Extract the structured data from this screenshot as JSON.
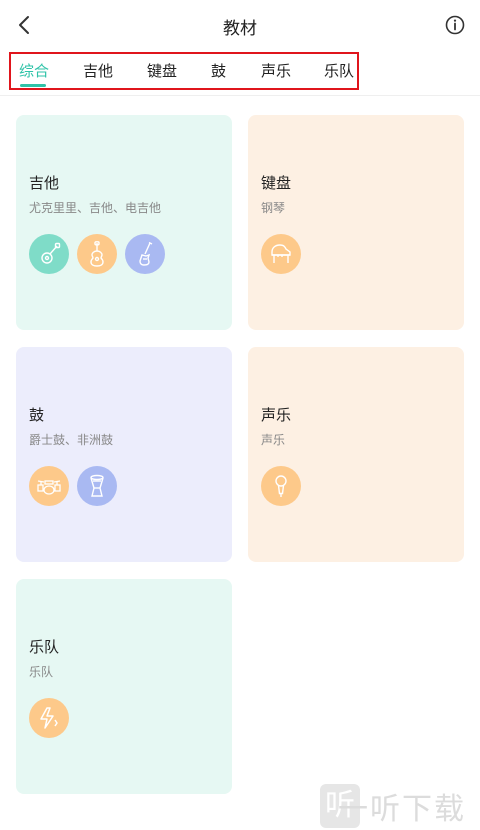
{
  "header": {
    "title": "教材",
    "back_icon": "chevron-left-icon",
    "info_icon": "info-icon"
  },
  "tabs": [
    {
      "label": "综合",
      "active": true
    },
    {
      "label": "吉他",
      "active": false
    },
    {
      "label": "键盘",
      "active": false
    },
    {
      "label": "鼓",
      "active": false
    },
    {
      "label": "声乐",
      "active": false
    },
    {
      "label": "乐队",
      "active": false
    }
  ],
  "colors": {
    "accent": "#2fc3a8",
    "highlight_border": "#e0151c",
    "card_mint": "#e6f8f3",
    "card_peach": "#fdf0e3",
    "card_lavender": "#ecedfc",
    "icon_teal": "#7fdcc8",
    "icon_orange": "#fdc98a",
    "icon_blue": "#a9b9f2"
  },
  "cards": [
    {
      "title": "吉他",
      "subtitle": "尤克里里、吉他、电吉他",
      "icons": [
        "ukulele-icon",
        "guitar-icon",
        "electric-guitar-icon"
      ]
    },
    {
      "title": "键盘",
      "subtitle": "钢琴",
      "icons": [
        "piano-icon"
      ]
    },
    {
      "title": "鼓",
      "subtitle": "爵士鼓、非洲鼓",
      "icons": [
        "drum-kit-icon",
        "djembe-icon"
      ]
    },
    {
      "title": "声乐",
      "subtitle": "声乐",
      "icons": [
        "microphone-icon"
      ]
    },
    {
      "title": "乐队",
      "subtitle": "乐队",
      "icons": [
        "band-lightning-icon"
      ]
    }
  ],
  "watermark": {
    "text": "一听下载",
    "mark": "听"
  }
}
